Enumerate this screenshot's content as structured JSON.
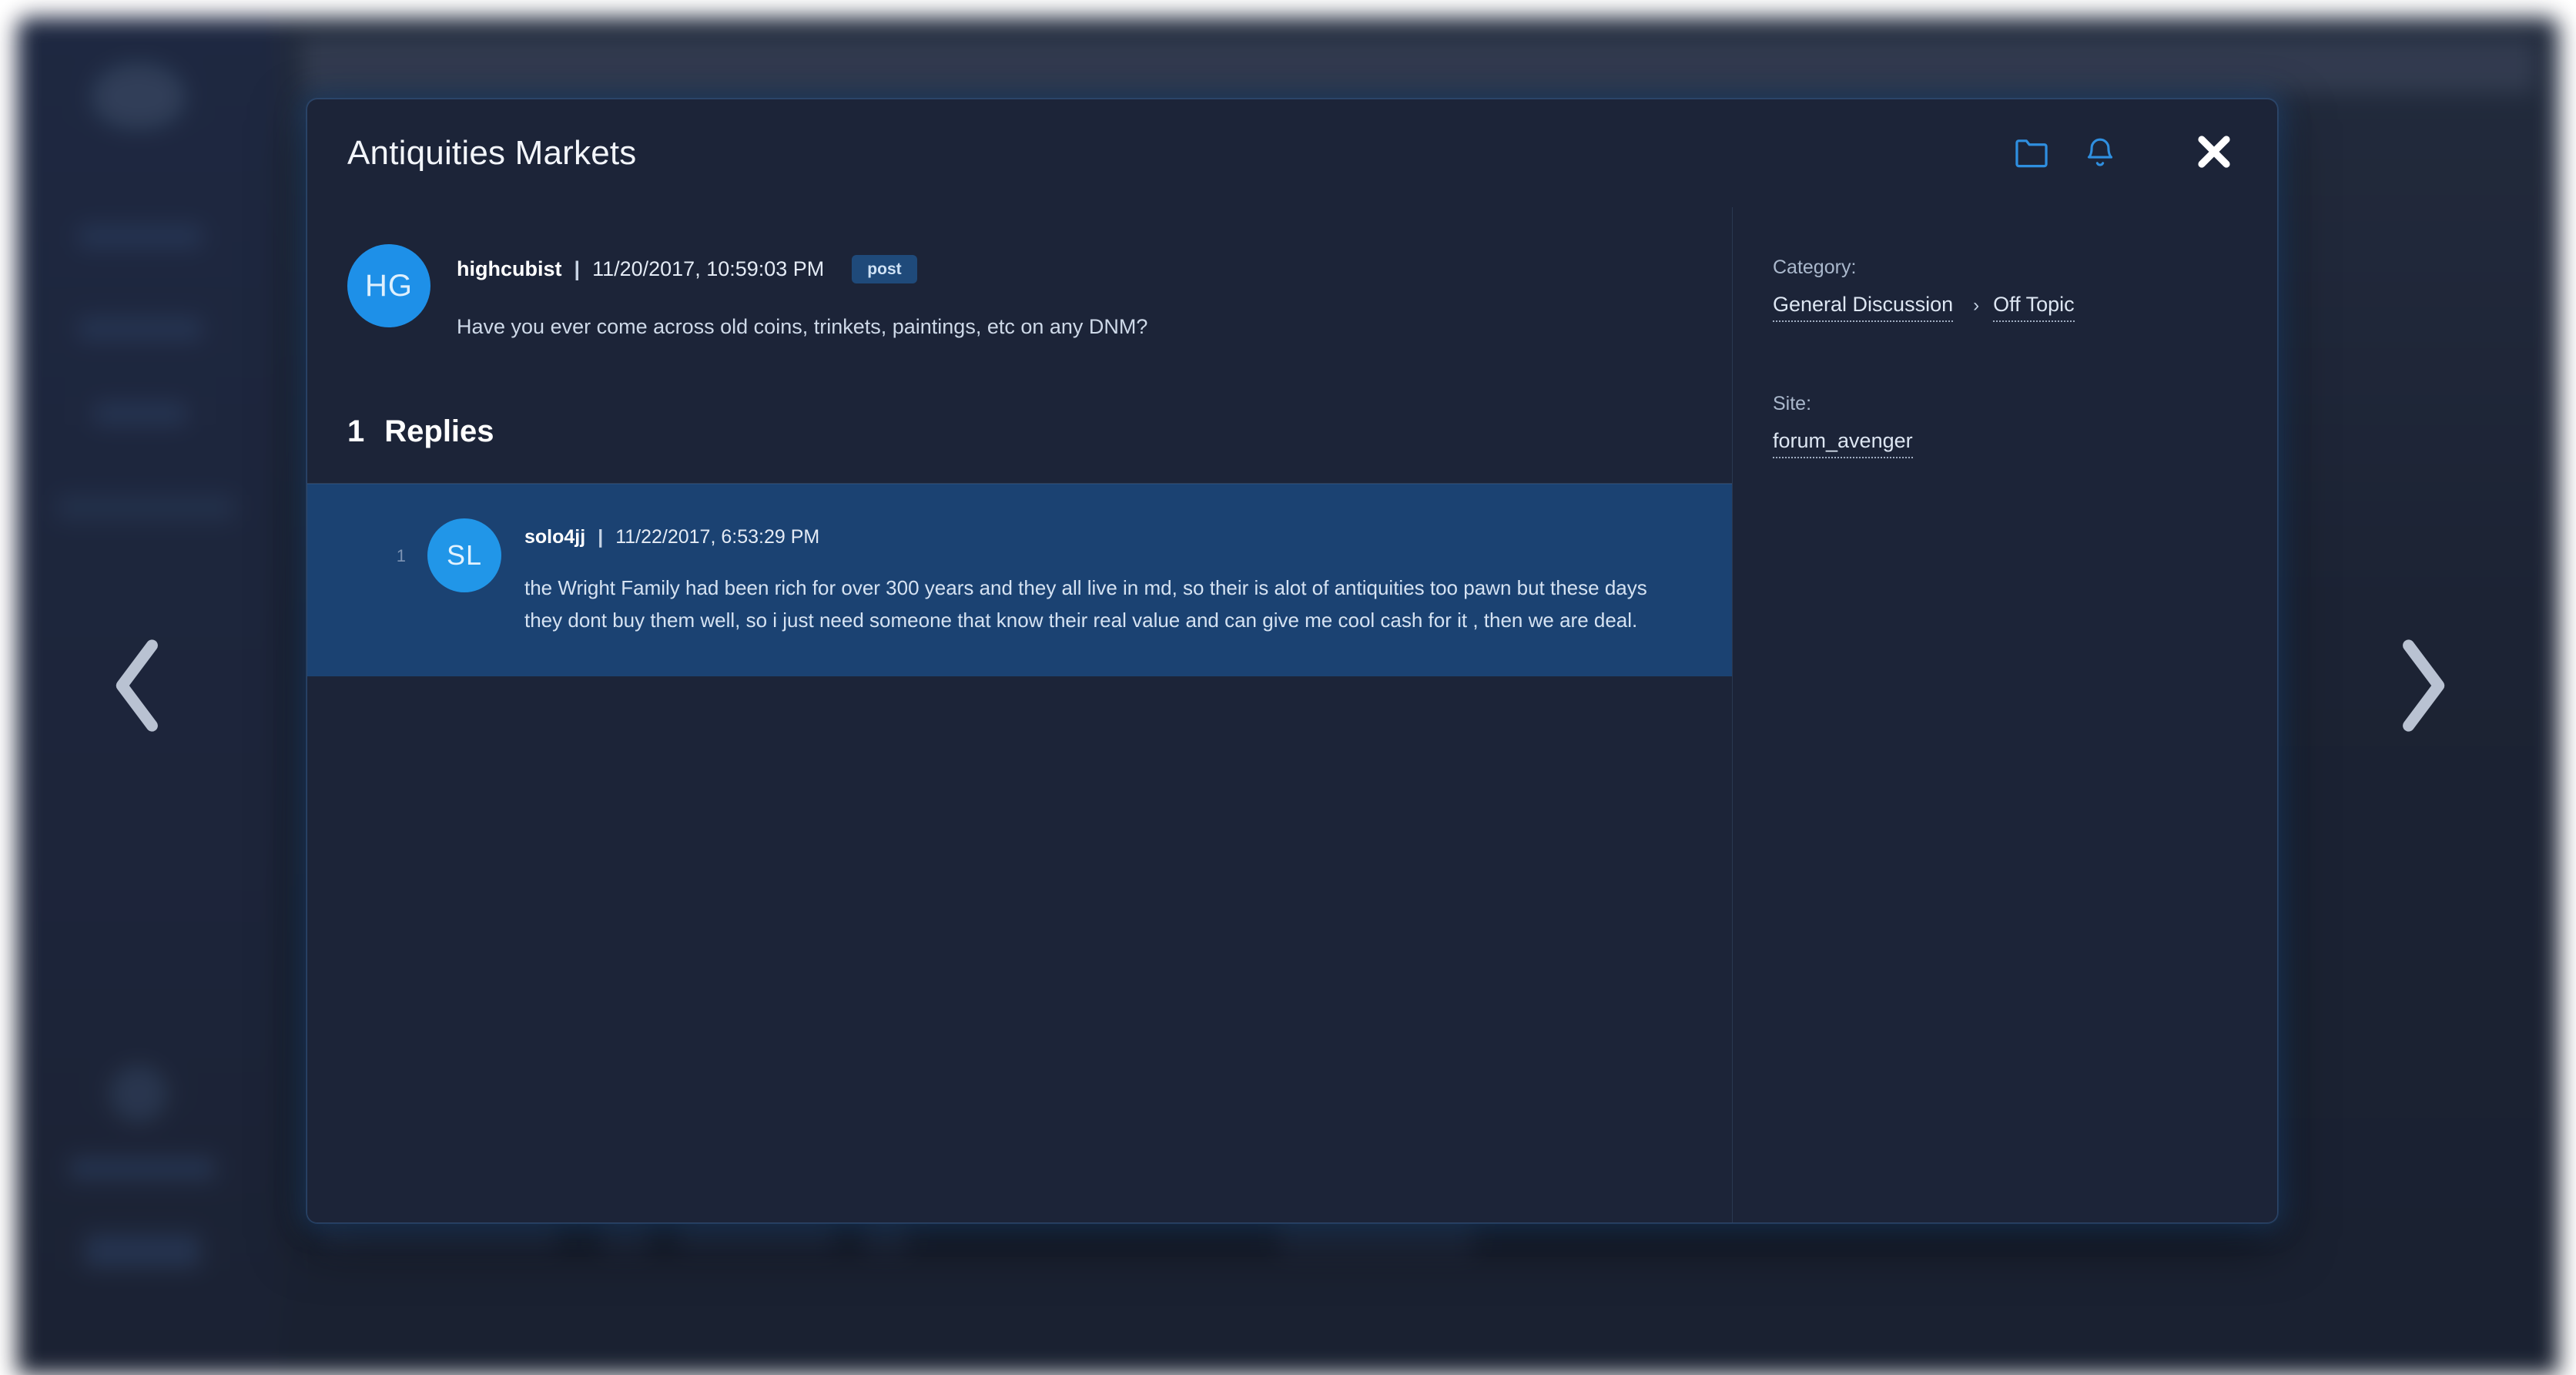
{
  "modal": {
    "title": "Antiquities Markets",
    "header_icons": [
      {
        "name": "folder-icon",
        "label": "folder"
      },
      {
        "name": "bell-icon",
        "label": "notifications"
      }
    ],
    "close_label": "✖"
  },
  "original_post": {
    "avatar_initials": "HG",
    "username": "highcubist",
    "separator": "|",
    "timestamp": "11/20/2017, 10:59:03 PM",
    "badge": "post",
    "body": "Have you ever come across old coins, trinkets, paintings, etc on any DNM?"
  },
  "replies_section": {
    "count": "1",
    "label": "Replies"
  },
  "replies": [
    {
      "index": "1",
      "avatar_initials": "SL",
      "username": "solo4jj",
      "separator": "|",
      "timestamp": "11/22/2017, 6:53:29 PM",
      "body": "the Wright Family had been rich for over 300 years and they all live in md, so their is alot of antiquities too pawn but these days they dont buy them well, so i just need someone that know their real value and can give me cool cash for it , then we are deal."
    }
  ],
  "sidebar_panel": {
    "category": {
      "label": "Category:",
      "primary": "General Discussion",
      "chevron": "›",
      "secondary": "Off Topic"
    },
    "site": {
      "label": "Site:",
      "value": "forum_avenger"
    }
  },
  "navigation": {
    "prev_label": "previous",
    "next_label": "next"
  },
  "colors": {
    "modal_bg": "#1c2438",
    "reply_highlight": "#1b4272",
    "avatar_blue": "#1e90e8",
    "badge_bg": "#1f4a7a",
    "icon_blue": "#2f8fe0",
    "page_bg": "#121a2b"
  }
}
